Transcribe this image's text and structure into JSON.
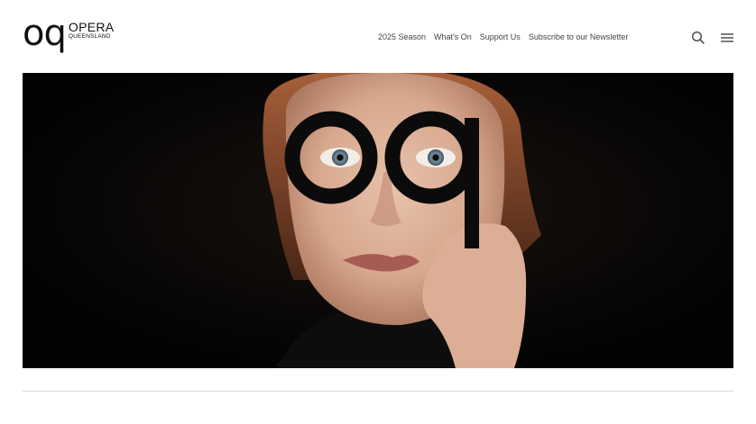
{
  "logo": {
    "mark": "oq",
    "line1": "OPERA",
    "line2": "QUEENSLAND"
  },
  "nav": {
    "items": [
      {
        "label": "2025 Season"
      },
      {
        "label": "What's On"
      },
      {
        "label": "Support Us"
      },
      {
        "label": "Subscribe to our Newsletter"
      }
    ]
  },
  "header_icons": {
    "search": "search-icon",
    "menu": "hamburger-menu-icon"
  },
  "hero": {
    "overlay_mark": "oq",
    "background_color": "#050505"
  }
}
